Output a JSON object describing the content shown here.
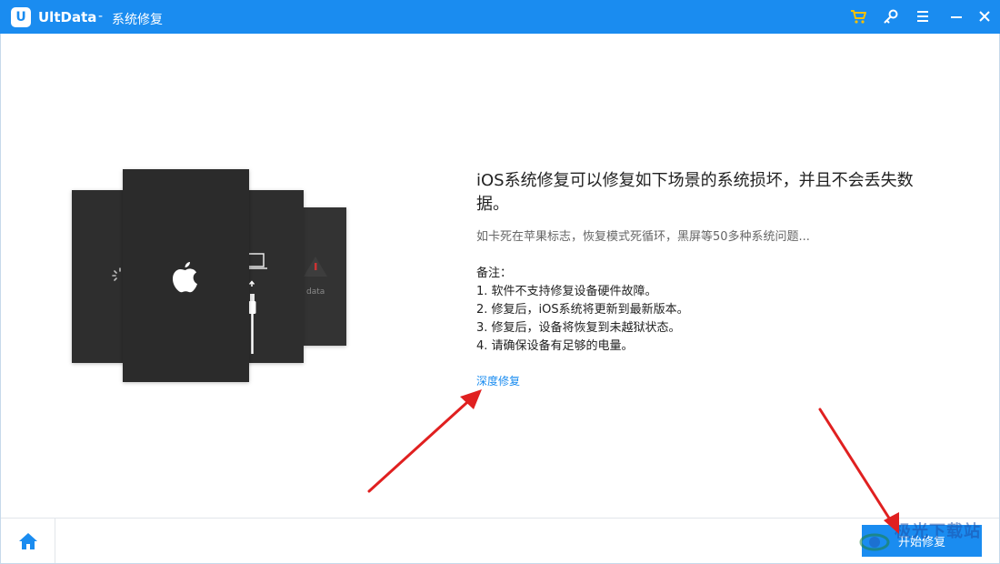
{
  "titlebar": {
    "logo_letter": "U",
    "app_name": "UltData",
    "separator": "-",
    "module": "系统修复"
  },
  "illustration": {
    "data_label": "data"
  },
  "main": {
    "title": "iOS系统修复可以修复如下场景的系统损坏，并且不会丢失数据。",
    "subtitle": "如卡死在苹果标志，恢复模式死循环，黑屏等50多种系统问题...",
    "notes_heading": "备注：",
    "notes": [
      "1. 软件不支持修复设备硬件故障。",
      "2. 修复后，iOS系统将更新到最新版本。",
      "3. 修复后，设备将恢复到未越狱状态。",
      "4. 请确保设备有足够的电量。"
    ],
    "deep_repair_link": "深度修复"
  },
  "footer": {
    "start_button": "开始修复"
  },
  "watermark": {
    "text": "极光下载站"
  },
  "colors": {
    "brand": "#1a8cf0",
    "cart": "#f5c000",
    "annotation_arrow": "#e02020"
  }
}
